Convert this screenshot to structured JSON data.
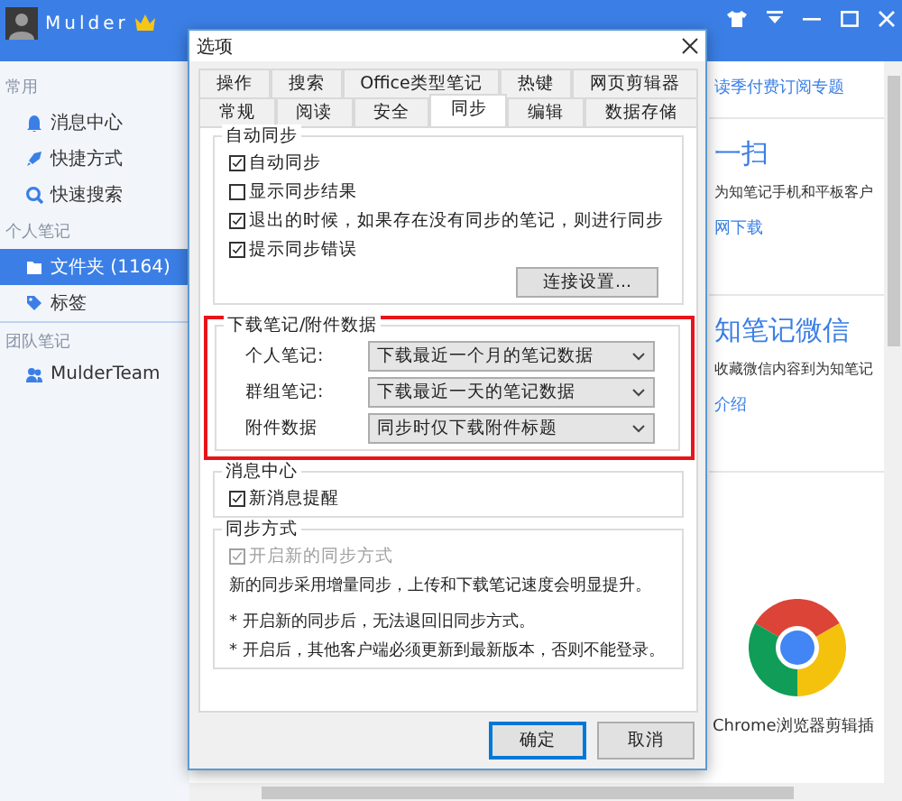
{
  "app": {
    "user": "Mulder"
  },
  "sidebar": [
    {
      "title": "常用",
      "items": [
        {
          "label": "消息中心",
          "selected": false
        },
        {
          "label": "快捷方式",
          "selected": false
        },
        {
          "label": "快速搜索",
          "selected": false
        }
      ]
    },
    {
      "title": "个人笔记",
      "items": [
        {
          "label": "文件夹 (1164)",
          "selected": true
        },
        {
          "label": "标签",
          "selected": false
        }
      ]
    },
    {
      "title": "团队笔记",
      "items": [
        {
          "label": "MulderTeam",
          "selected": false
        }
      ]
    }
  ],
  "main": {
    "subscription_link": "读季付费订阅专题",
    "scan": {
      "title": "一扫",
      "text": "为知笔记手机和平板客户",
      "link": "网下载"
    },
    "wechat": {
      "title": "知笔记微信",
      "text": "收藏微信内容到为知笔记",
      "link": "介绍"
    },
    "plugin_caption": "Chrome浏览器剪辑插"
  },
  "dialog": {
    "title": "选项",
    "tab_rows": [
      [
        {
          "label": "操作",
          "selected": false
        },
        {
          "label": "搜索",
          "selected": false
        },
        {
          "label": "Office类型笔记",
          "selected": false
        },
        {
          "label": "热键",
          "selected": false
        },
        {
          "label": "网页剪辑器",
          "selected": false
        }
      ],
      [
        {
          "label": "常规",
          "selected": false
        },
        {
          "label": "阅读",
          "selected": false
        },
        {
          "label": "安全",
          "selected": false
        },
        {
          "label": "同步",
          "selected": true
        },
        {
          "label": "编辑",
          "selected": false
        },
        {
          "label": "数据存储",
          "selected": false
        }
      ]
    ],
    "groups": [
      {
        "title": "自动同步",
        "highlighted": false,
        "items": [
          {
            "kind": "checkbox",
            "label": "自动同步",
            "checked": true,
            "disabled": false
          },
          {
            "kind": "checkbox",
            "label": "显示同步结果",
            "checked": false,
            "disabled": false
          },
          {
            "kind": "checkbox",
            "label": "退出的时候，如果存在没有同步的笔记，则进行同步",
            "checked": true,
            "disabled": false
          },
          {
            "kind": "checkbox",
            "label": "提示同步错误",
            "checked": true,
            "disabled": false
          },
          {
            "kind": "button",
            "label": "连接设置..."
          }
        ]
      },
      {
        "title": "下载笔记/附件数据",
        "highlighted": true,
        "items": [
          {
            "kind": "select",
            "label": "个人笔记:",
            "value": "下载最近一个月的笔记数据"
          },
          {
            "kind": "select",
            "label": "群组笔记:",
            "value": "下载最近一天的笔记数据"
          },
          {
            "kind": "select",
            "label": "附件数据",
            "value": "同步时仅下载附件标题"
          }
        ]
      },
      {
        "title": "消息中心",
        "highlighted": false,
        "items": [
          {
            "kind": "checkbox",
            "label": "新消息提醒",
            "checked": true,
            "disabled": false
          }
        ]
      },
      {
        "title": "同步方式",
        "highlighted": false,
        "items": [
          {
            "kind": "checkbox",
            "label": "开启新的同步方式",
            "checked": true,
            "disabled": true
          },
          {
            "kind": "text",
            "text": "新的同步采用增量同步，上传和下载笔记速度会明显提升。"
          },
          {
            "kind": "note",
            "text": "* 开启新的同步后，无法退回旧同步方式。"
          },
          {
            "kind": "text",
            "text": "* 开启后，其他客户端必须更新到最新版本，否则不能登录。"
          }
        ]
      }
    ],
    "buttons": [
      {
        "label": "确定",
        "selected": true
      },
      {
        "label": "取消",
        "selected": false
      }
    ]
  }
}
